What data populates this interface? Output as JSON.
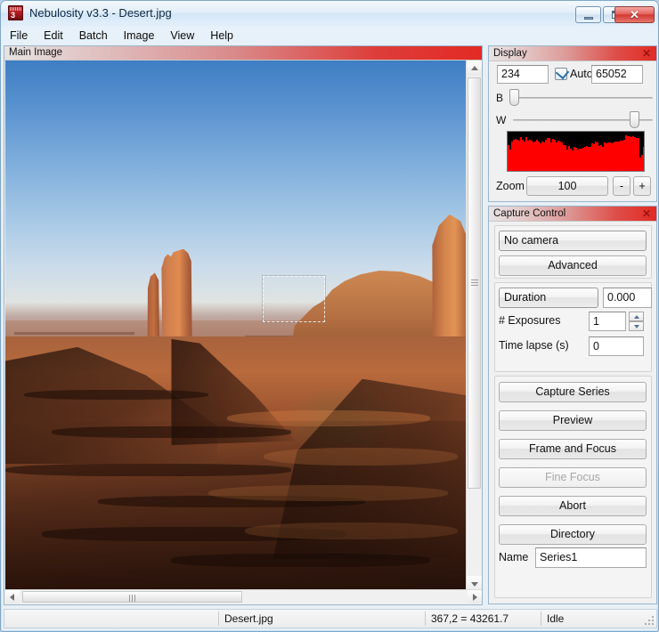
{
  "window": {
    "title": "Nebulosity v3.3 - Desert.jpg",
    "icon": "app-icon",
    "icon_digit": "3",
    "controls": {
      "minimize": "minimize-button",
      "maximize": "maximize-button",
      "close_glyph": "✕"
    }
  },
  "menu": {
    "items": [
      {
        "label": "File"
      },
      {
        "label": "Edit"
      },
      {
        "label": "Batch"
      },
      {
        "label": "Image"
      },
      {
        "label": "View"
      },
      {
        "label": "Help"
      }
    ]
  },
  "image_pane": {
    "title": "Main Image",
    "image_name": "Desert.jpg"
  },
  "display_panel": {
    "title": "Display",
    "close_glyph": "✕",
    "black_value": "234",
    "white_value": "65052",
    "auto_label": "Auto",
    "auto_checked": true,
    "slider_b_label": "B",
    "slider_w_label": "W",
    "histogram_color": "#ff0000",
    "histogram_bg": "#000000",
    "zoom_label": "Zoom",
    "zoom_value": "100",
    "zoom_minus": "-",
    "zoom_plus": "+"
  },
  "capture_panel": {
    "title": "Capture Control",
    "close_glyph": "✕",
    "camera_selected": "No camera",
    "advanced_label": "Advanced",
    "mode_selected": "Duration",
    "duration_value": "0.000",
    "exposures_label": "# Exposures",
    "exposures_value": "1",
    "timelapse_label": "Time lapse (s)",
    "timelapse_value": "0",
    "buttons": [
      {
        "label": "Capture Series",
        "enabled": true
      },
      {
        "label": "Preview",
        "enabled": true
      },
      {
        "label": "Frame and Focus",
        "enabled": true
      },
      {
        "label": "Fine Focus",
        "enabled": false
      },
      {
        "label": "Abort",
        "enabled": true
      },
      {
        "label": "Directory",
        "enabled": true
      }
    ],
    "name_label": "Name",
    "name_value": "Series1"
  },
  "status_bar": {
    "cell1": "",
    "cell2": "Desert.jpg",
    "cell3": "367,2 = 43261.7",
    "cell4": "Idle"
  },
  "colors": {
    "panel_title_accent": "#e32a24",
    "window_border": "#7ea6c9",
    "histogram_red": "#ff0000"
  }
}
